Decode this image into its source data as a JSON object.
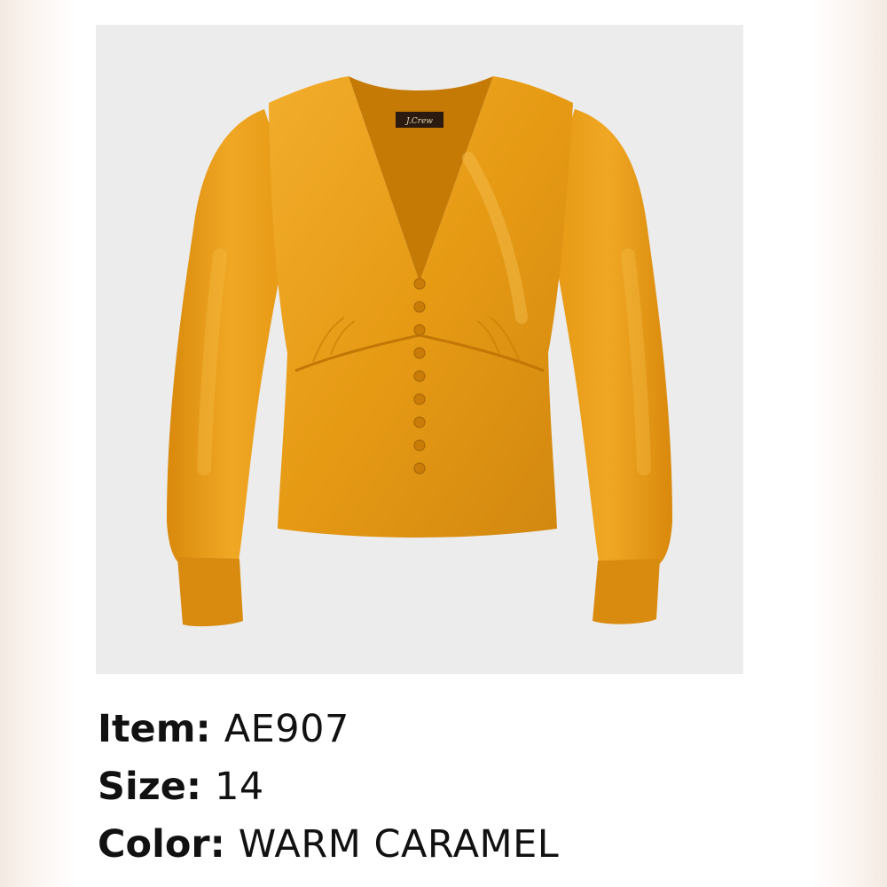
{
  "product": {
    "brand_mark": "J.Crew",
    "image_description_icon": "blouse-photo",
    "colors": {
      "fabric": "#e69a14",
      "fabric_shadow": "#c97f08",
      "fabric_highlight": "#f4b336",
      "photo_background": "#ececec"
    }
  },
  "details": [
    {
      "label": "Item:",
      "value": "AE907"
    },
    {
      "label": "Size:",
      "value": "14"
    },
    {
      "label": "Color:",
      "value": "WARM CARAMEL"
    }
  ]
}
